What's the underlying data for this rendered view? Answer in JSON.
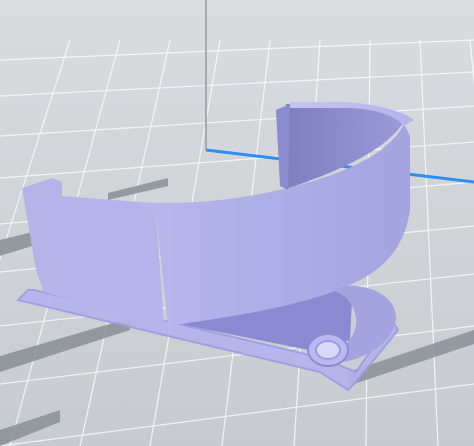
{
  "viewer": {
    "mode": "3d-print-preview",
    "background_color": "#cfd2d6",
    "grid_color": "#ffffff",
    "bed_stripe_color": "#8a8f96",
    "axis_x_color": "#2f8ff0",
    "axis_z_color": "#b0b3b8",
    "model_color": "#a9a9e6",
    "model_shadow_color": "#7c7cc6",
    "skirt_color": "#b3b3ee"
  }
}
